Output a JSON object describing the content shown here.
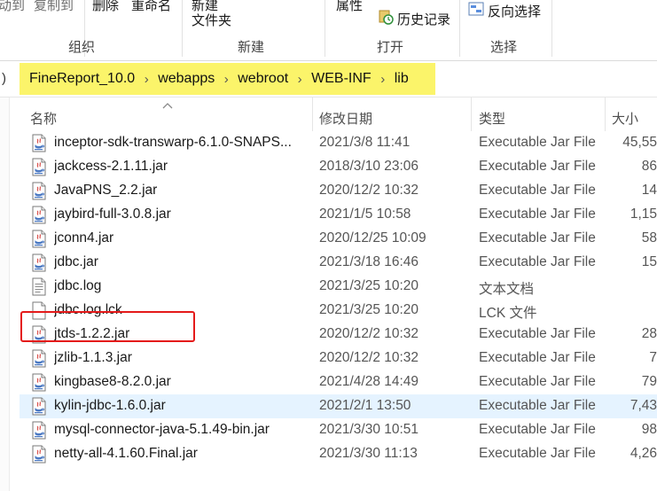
{
  "ribbon": {
    "clip_left_1": "动到",
    "clip_left_2": "复制到",
    "delete": "删除",
    "rename": "重命名",
    "new_line1": "新建",
    "new_line2": "文件夹",
    "properties": "属性",
    "history": "历史记录",
    "invert_selection": "反向选择",
    "groups": {
      "organize": "组织",
      "new": "新建",
      "open": "打开",
      "select": "选择"
    }
  },
  "address": {
    "lead": ")",
    "crumbs": [
      "FineReport_10.0",
      "webapps",
      "webroot",
      "WEB-INF",
      "lib"
    ],
    "highlight_color": "#fbf46a"
  },
  "columns": {
    "name": "名称",
    "date": "修改日期",
    "type": "类型",
    "size": "大小"
  },
  "files": [
    {
      "name": "inceptor-sdk-transwarp-6.1.0-SNAPS...",
      "date": "2021/3/8 11:41",
      "type": "Executable Jar File",
      "size": "45,55",
      "icon": "jar-icon"
    },
    {
      "name": "jackcess-2.1.11.jar",
      "date": "2018/3/10 23:06",
      "type": "Executable Jar File",
      "size": "86",
      "icon": "jar-icon"
    },
    {
      "name": "JavaPNS_2.2.jar",
      "date": "2020/12/2 10:32",
      "type": "Executable Jar File",
      "size": "14",
      "icon": "jar-icon"
    },
    {
      "name": "jaybird-full-3.0.8.jar",
      "date": "2021/1/5 10:58",
      "type": "Executable Jar File",
      "size": "1,15",
      "icon": "jar-icon"
    },
    {
      "name": "jconn4.jar",
      "date": "2020/12/25 10:09",
      "type": "Executable Jar File",
      "size": "58",
      "icon": "jar-icon"
    },
    {
      "name": "jdbc.jar",
      "date": "2021/3/18 16:46",
      "type": "Executable Jar File",
      "size": "15",
      "icon": "jar-icon"
    },
    {
      "name": "jdbc.log",
      "date": "2021/3/25 10:20",
      "type": "文本文档",
      "size": "",
      "icon": "text-file-icon"
    },
    {
      "name": "jdbc.log.lck",
      "date": "2021/3/25 10:20",
      "type": "LCK 文件",
      "size": "",
      "icon": "blank-file-icon"
    },
    {
      "name": "jtds-1.2.2.jar",
      "date": "2020/12/2 10:32",
      "type": "Executable Jar File",
      "size": "28",
      "icon": "jar-icon"
    },
    {
      "name": "jzlib-1.1.3.jar",
      "date": "2020/12/2 10:32",
      "type": "Executable Jar File",
      "size": "7",
      "icon": "jar-icon"
    },
    {
      "name": "kingbase8-8.2.0.jar",
      "date": "2021/4/28 14:49",
      "type": "Executable Jar File",
      "size": "79",
      "icon": "jar-icon"
    },
    {
      "name": "kylin-jdbc-1.6.0.jar",
      "date": "2021/2/1 13:50",
      "type": "Executable Jar File",
      "size": "7,43",
      "icon": "jar-icon",
      "selected": true
    },
    {
      "name": "mysql-connector-java-5.1.49-bin.jar",
      "date": "2021/3/30 10:51",
      "type": "Executable Jar File",
      "size": "98",
      "icon": "jar-icon"
    },
    {
      "name": "netty-all-4.1.60.Final.jar",
      "date": "2021/3/30 11:13",
      "type": "Executable Jar File",
      "size": "4,26",
      "icon": "jar-icon"
    }
  ],
  "colors": {
    "selection": "#e5f3ff",
    "annotation_box": "#e41a1a"
  }
}
